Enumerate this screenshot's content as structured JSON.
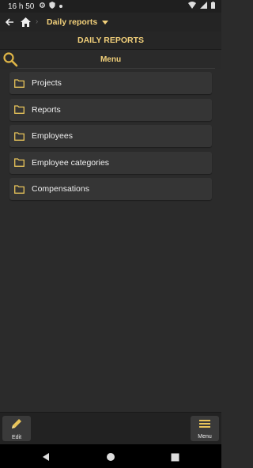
{
  "status_bar": {
    "time": "16 h 50"
  },
  "toolbar": {
    "title": "Daily reports"
  },
  "header": {
    "title": "DAILY REPORTS"
  },
  "search": {
    "label": "Menu"
  },
  "menu_items": [
    {
      "label": "Projects"
    },
    {
      "label": "Reports"
    },
    {
      "label": "Employees"
    },
    {
      "label": "Employee categories"
    },
    {
      "label": "Compensations"
    }
  ],
  "bottom_bar": {
    "edit_label": "Edit",
    "menu_label": "Menu"
  },
  "colors": {
    "accent": "#f2d07a",
    "background": "#2b2b2b",
    "item_bg": "#353535"
  }
}
